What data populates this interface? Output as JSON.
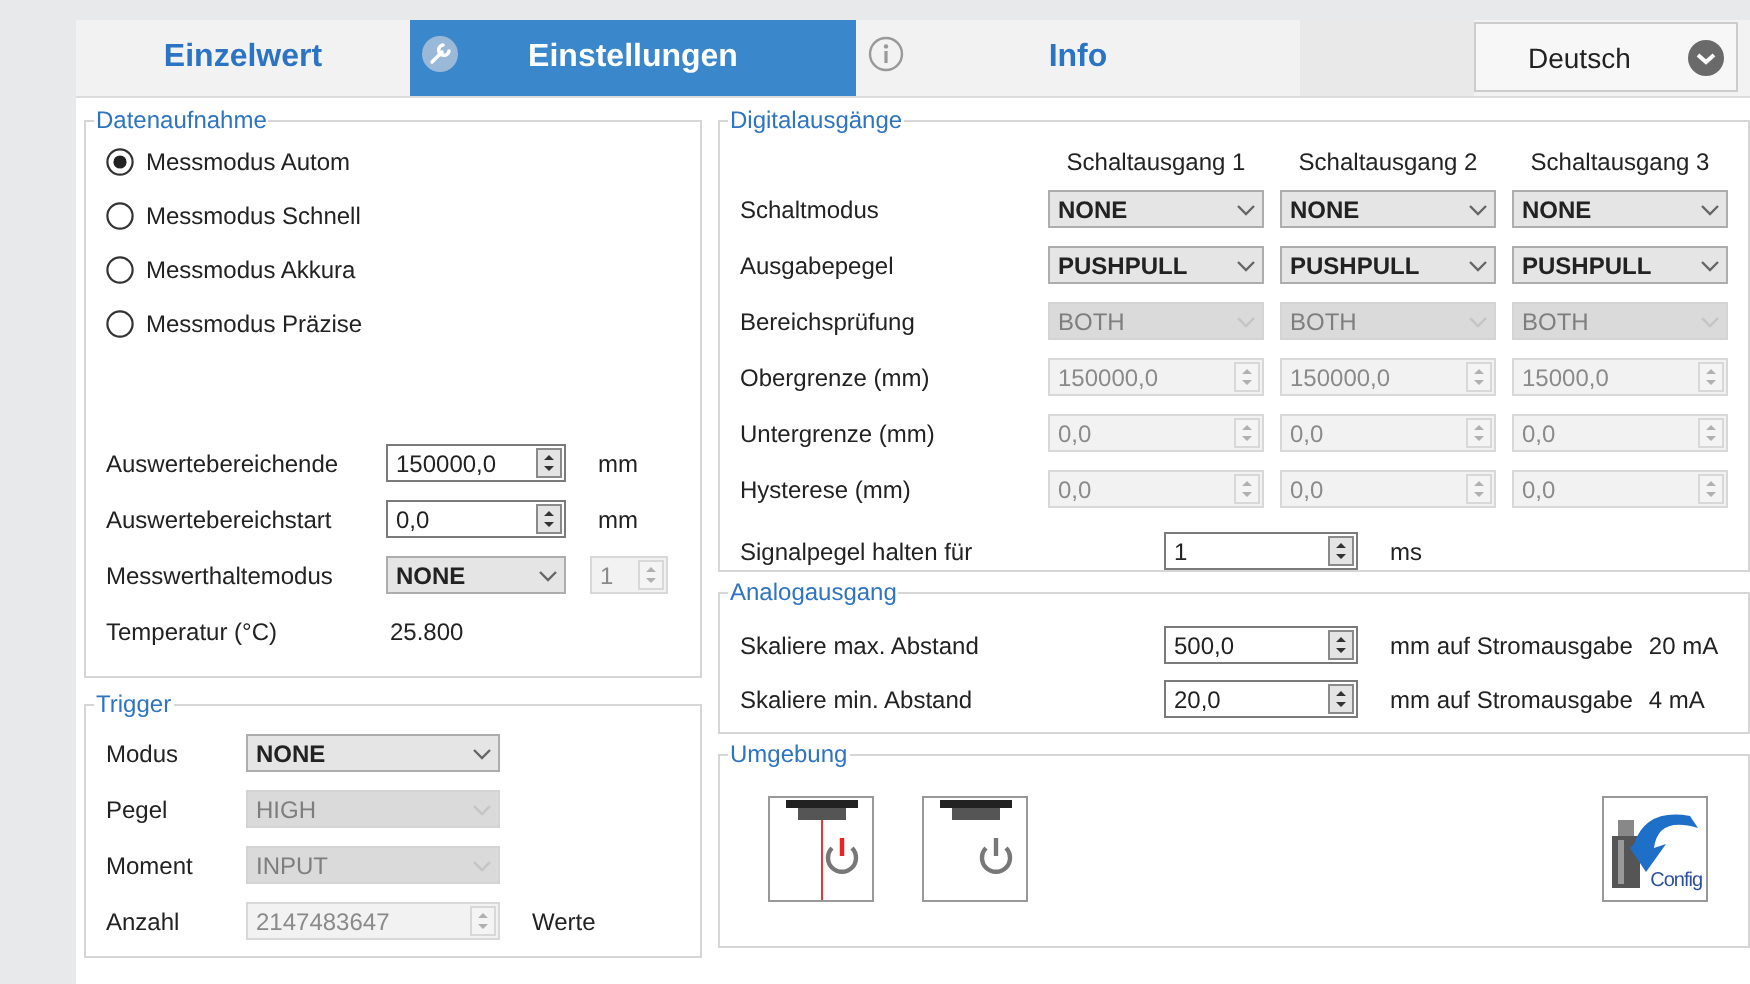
{
  "tabs": [
    {
      "label": "Einzelwert",
      "selected": false
    },
    {
      "label": "Einstellungen",
      "selected": true
    },
    {
      "label": "Info",
      "selected": false
    }
  ],
  "language": "Deutsch",
  "acquisition": {
    "title": "Datenaufnahme",
    "modes": [
      {
        "label": "Messmodus Autom",
        "selected": true
      },
      {
        "label": "Messmodus Schnell",
        "selected": false
      },
      {
        "label": "Messmodus Akkura",
        "selected": false
      },
      {
        "label": "Messmodus Präzise",
        "selected": false
      }
    ],
    "rows": [
      {
        "label": "Auswertebereichende",
        "control": {
          "kind": "spin",
          "value": "150000,0",
          "disabled": false
        },
        "unit": "mm"
      },
      {
        "label": "Auswertebereichstart",
        "control": {
          "kind": "spin",
          "value": "0,0",
          "disabled": false
        },
        "unit": "mm"
      },
      {
        "label": "Messwerthaltemodus",
        "control": {
          "kind": "select",
          "value": "NONE",
          "disabled": false
        },
        "extra": {
          "kind": "spin",
          "value": "1",
          "disabled": true
        }
      },
      {
        "label": "Temperatur (°C)",
        "reading": "25.800"
      }
    ]
  },
  "trigger": {
    "title": "Trigger",
    "rows": [
      {
        "label": "Modus",
        "control": {
          "kind": "select",
          "value": "NONE",
          "disabled": false
        }
      },
      {
        "label": "Pegel",
        "control": {
          "kind": "select",
          "value": "HIGH",
          "disabled": true
        }
      },
      {
        "label": "Moment",
        "control": {
          "kind": "select",
          "value": "INPUT",
          "disabled": true
        }
      },
      {
        "label": "Anzahl",
        "control": {
          "kind": "spin",
          "value": "2147483647",
          "disabled": true
        },
        "unit": "Werte"
      }
    ]
  },
  "digital": {
    "title": "Digitalausgänge",
    "columns": [
      "Schaltausgang 1",
      "Schaltausgang 2",
      "Schaltausgang 3"
    ],
    "rows": [
      {
        "label": "Schaltmodus",
        "cells": [
          {
            "kind": "select",
            "value": "NONE",
            "disabled": false
          },
          {
            "kind": "select",
            "value": "NONE",
            "disabled": false
          },
          {
            "kind": "select",
            "value": "NONE",
            "disabled": false
          }
        ]
      },
      {
        "label": "Ausgabepegel",
        "cells": [
          {
            "kind": "select",
            "value": "PUSHPULL",
            "disabled": false
          },
          {
            "kind": "select",
            "value": "PUSHPULL",
            "disabled": false
          },
          {
            "kind": "select",
            "value": "PUSHPULL",
            "disabled": false
          }
        ]
      },
      {
        "label": "Bereichsprüfung",
        "cells": [
          {
            "kind": "select",
            "value": "BOTH",
            "disabled": true
          },
          {
            "kind": "select",
            "value": "BOTH",
            "disabled": true
          },
          {
            "kind": "select",
            "value": "BOTH",
            "disabled": true
          }
        ]
      },
      {
        "label": "Obergrenze (mm)",
        "cells": [
          {
            "kind": "spin",
            "value": "150000,0",
            "disabled": true
          },
          {
            "kind": "spin",
            "value": "150000,0",
            "disabled": true
          },
          {
            "kind": "spin",
            "value": "15000,0",
            "disabled": true
          }
        ]
      },
      {
        "label": "Untergrenze (mm)",
        "cells": [
          {
            "kind": "spin",
            "value": "0,0",
            "disabled": true
          },
          {
            "kind": "spin",
            "value": "0,0",
            "disabled": true
          },
          {
            "kind": "spin",
            "value": "0,0",
            "disabled": true
          }
        ]
      },
      {
        "label": "Hysterese (mm)",
        "cells": [
          {
            "kind": "spin",
            "value": "0,0",
            "disabled": true
          },
          {
            "kind": "spin",
            "value": "0,0",
            "disabled": true
          },
          {
            "kind": "spin",
            "value": "0,0",
            "disabled": true
          }
        ]
      }
    ],
    "hold": {
      "label": "Signalpegel halten für",
      "control": {
        "kind": "spin",
        "value": "1",
        "disabled": false
      },
      "unit": "ms"
    }
  },
  "analog": {
    "title": "Analogausgang",
    "rows": [
      {
        "label": "Skaliere max. Abstand",
        "control": {
          "kind": "spin",
          "value": "500,0",
          "disabled": false
        },
        "unit": "mm auf Stromausgabe",
        "current": "20 mA"
      },
      {
        "label": "Skaliere min. Abstand",
        "control": {
          "kind": "spin",
          "value": "20,0",
          "disabled": false
        },
        "unit": "mm auf Stromausgabe",
        "current": "4 mA"
      }
    ]
  },
  "environment": {
    "title": "Umgebung",
    "sensors": [
      {
        "laser": true
      },
      {
        "laser": false
      }
    ],
    "config": "Config"
  }
}
